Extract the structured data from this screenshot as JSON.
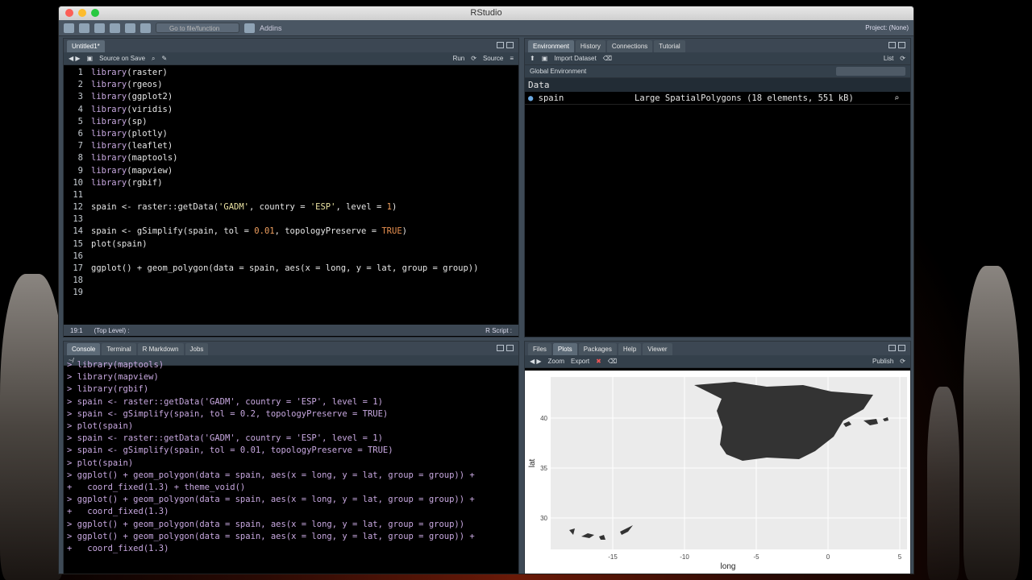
{
  "window": {
    "title": "RStudio"
  },
  "toolbar": {
    "goto_placeholder": "Go to file/function",
    "addins": "Addins",
    "project": "Project: (None)"
  },
  "editor": {
    "tab": "Untitled1*",
    "source_on_save": "Source on Save",
    "run": "Run",
    "source": "Source",
    "lines": [
      "library(raster)",
      "library(rgeos)",
      "library(ggplot2)",
      "library(viridis)",
      "library(sp)",
      "library(plotly)",
      "library(leaflet)",
      "library(maptools)",
      "library(mapview)",
      "library(rgbif)",
      "",
      "spain <- raster::getData('GADM', country = 'ESP', level = 1)",
      "",
      "spain <- gSimplify(spain, tol = 0.01, topologyPreserve = TRUE)",
      "plot(spain)",
      "",
      "ggplot() + geom_polygon(data = spain, aes(x = long, y = lat, group = group))",
      "",
      ""
    ],
    "status_pos": "19:1",
    "status_scope": "(Top Level) :",
    "status_type": "R Script :"
  },
  "console": {
    "tabs": [
      "Console",
      "Terminal",
      "R Markdown",
      "Jobs"
    ],
    "path": "~/",
    "lines": [
      "> library(maptools)",
      "> library(mapview)",
      "> library(rgbif)",
      "> spain <- raster::getData('GADM', country = 'ESP', level = 1)",
      "> spain <- gSimplify(spain, tol = 0.2, topologyPreserve = TRUE)",
      "> plot(spain)",
      "> spain <- raster::getData('GADM', country = 'ESP', level = 1)",
      "> spain <- gSimplify(spain, tol = 0.01, topologyPreserve = TRUE)",
      "> plot(spain)",
      "> ggplot() + geom_polygon(data = spain, aes(x = long, y = lat, group = group)) +",
      "+   coord_fixed(1.3) + theme_void()",
      "> ggplot() + geom_polygon(data = spain, aes(x = long, y = lat, group = group)) +",
      "+   coord_fixed(1.3)",
      "> ggplot() + geom_polygon(data = spain, aes(x = long, y = lat, group = group))",
      "> ggplot() + geom_polygon(data = spain, aes(x = long, y = lat, group = group)) +",
      "+   coord_fixed(1.3)",
      ""
    ]
  },
  "environment": {
    "tabs": [
      "Environment",
      "History",
      "Connections",
      "Tutorial"
    ],
    "import": "Import Dataset",
    "view": "List",
    "scope": "Global Environment",
    "section": "Data",
    "var_name": "spain",
    "var_value": "Large SpatialPolygons (18 elements, 551 kB)"
  },
  "files": {
    "tabs": [
      "Files",
      "Plots",
      "Packages",
      "Help",
      "Viewer"
    ],
    "zoom": "Zoom",
    "export": "Export",
    "publish": "Publish"
  },
  "plot": {
    "xlabel": "long",
    "ylabel": "lat",
    "xticks": [
      "-15",
      "-10",
      "-5",
      "0",
      "5"
    ],
    "yticks": [
      "40",
      "35",
      "30"
    ]
  }
}
